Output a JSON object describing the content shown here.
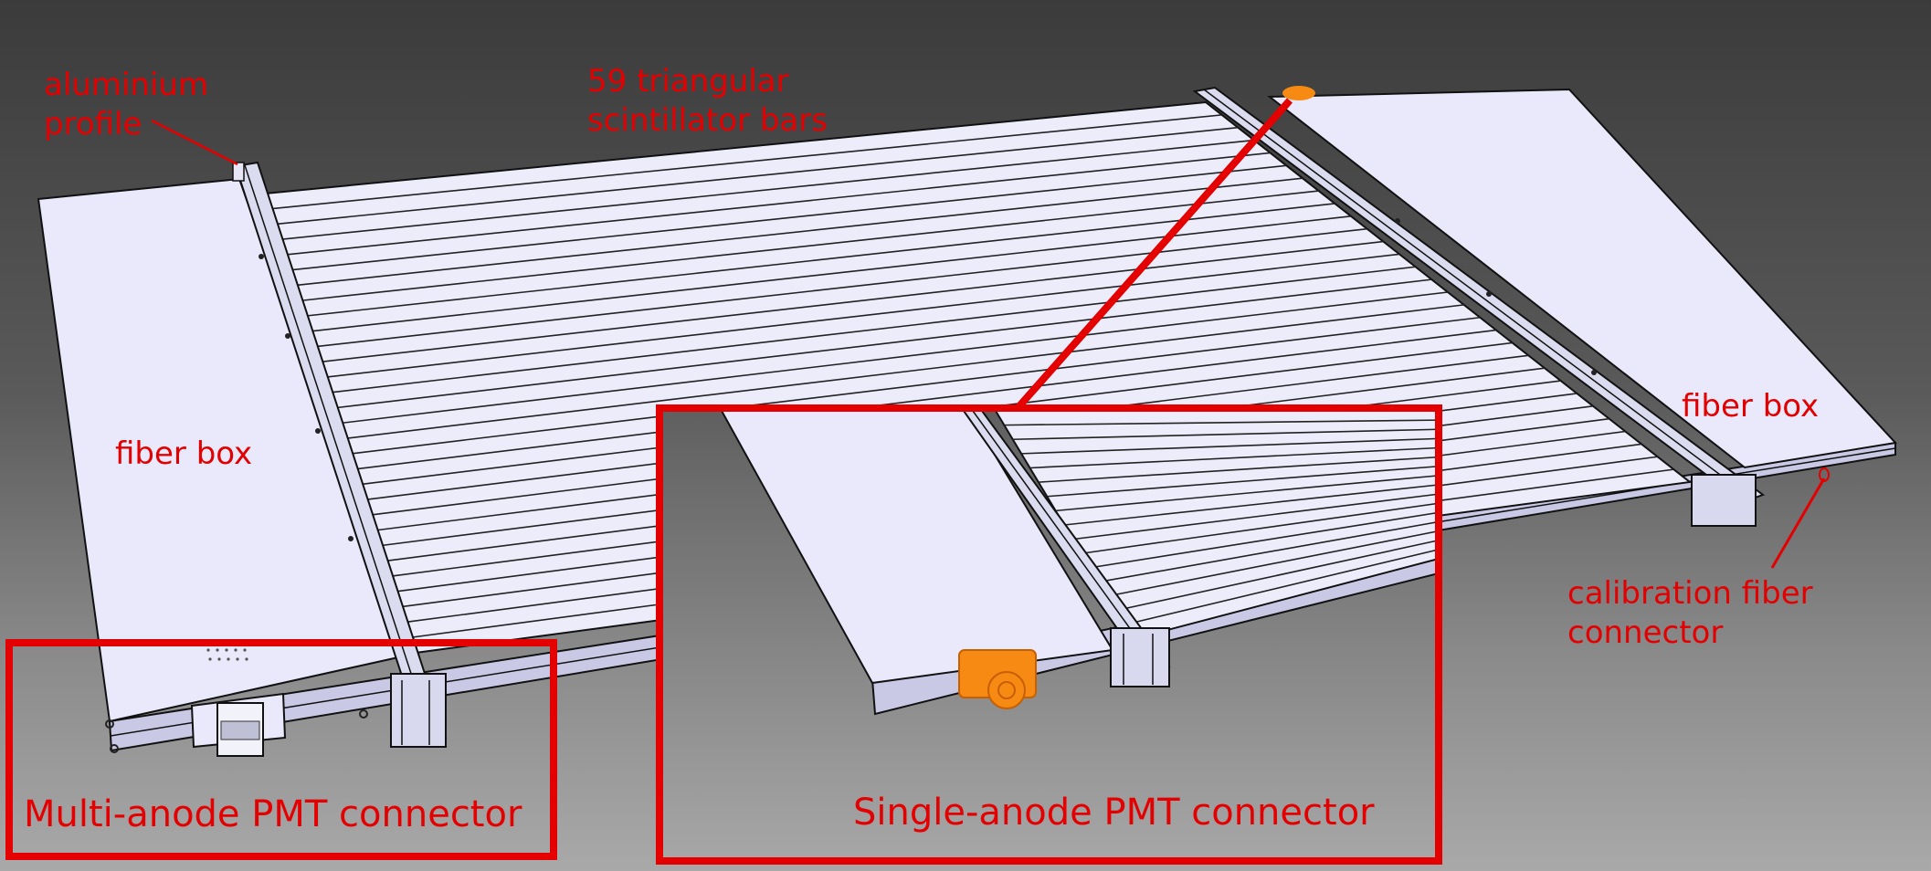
{
  "labels": {
    "aluminium_profile_line1": "aluminium",
    "aluminium_profile_line2": "profile",
    "bars_line1": "59 triangular",
    "bars_line2": "scintillator bars",
    "fiber_box_left": "fiber box",
    "fiber_box_right": "fiber box",
    "calibration_line1": "calibration fiber",
    "calibration_line2": "connector",
    "multi_anode": "Multi-anode PMT connector",
    "single_anode": "Single-anode PMT connector"
  },
  "colors": {
    "annotation": "#e40000",
    "panel_face": "#e9e9fb",
    "panel_edge": "#c9c9e6",
    "connector": "#f68a12",
    "background_top": "#3b3b3b",
    "background_bottom": "#a9a9a9"
  },
  "scene": {
    "bar_count": 59
  }
}
